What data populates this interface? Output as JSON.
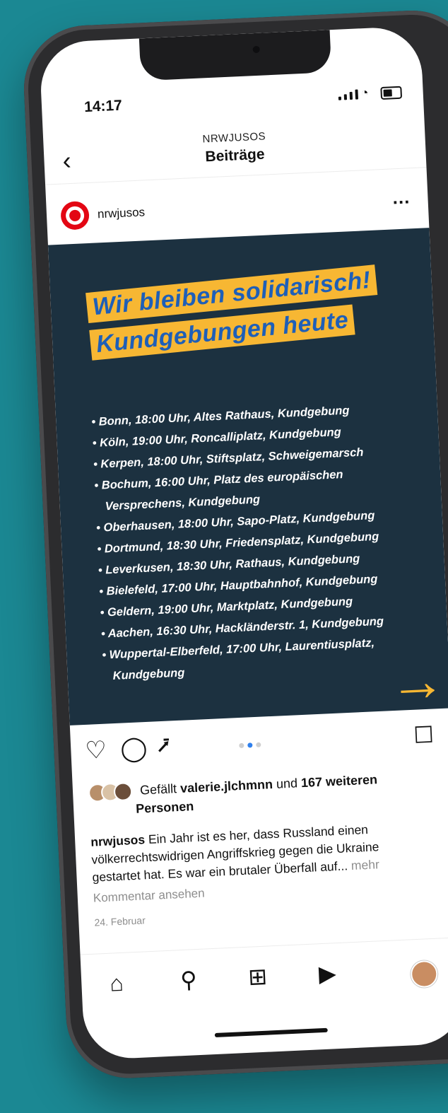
{
  "status": {
    "time": "14:17"
  },
  "header": {
    "account": "NRWJUSOS",
    "title": "Beiträge"
  },
  "post": {
    "username": "nrwjusos",
    "image": {
      "headline_line1": "Wir bleiben solidarisch!",
      "headline_line2": "Kundgebungen heute",
      "events": [
        "Bonn, 18:00 Uhr, Altes Rathaus, Kundgebung",
        "Köln, 19:00 Uhr, Roncalliplatz, Kundgebung",
        "Kerpen, 18:00 Uhr, Stiftsplatz, Schweigemarsch",
        "Bochum, 16:00 Uhr, Platz des europäischen Versprechens, Kundgebung",
        "Oberhausen, 18:00 Uhr, Sapo-Platz, Kundgebung",
        "Dortmund, 18:30 Uhr, Friedensplatz, Kundgebung",
        "Leverkusen, 18:30 Uhr, Rathaus, Kundgebung",
        "Bielefeld, 17:00 Uhr, Hauptbahnhof, Kundgebung",
        "Geldern, 19:00 Uhr, Marktplatz, Kundgebung",
        "Aachen, 16:30 Uhr, Hackländerstr. 1, Kundgebung",
        "Wuppertal-Elberfeld, 17:00 Uhr, Laurentiusplatz, Kundgebung"
      ]
    },
    "carousel": {
      "total": 3,
      "active": 2
    },
    "likes": {
      "prefix": "Gefällt",
      "user": "valerie.jlchmnn",
      "middle": "und",
      "count": "167 weiteren",
      "suffix": "Personen"
    },
    "caption": {
      "username": "nrwjusos",
      "text": "Ein Jahr ist es her, dass Russland einen völkerrechtswidrigen Angriffskrieg gegen die Ukraine gestartet hat. Es war ein brutaler Überfall auf...",
      "more": "mehr"
    },
    "comments_link": "Kommentar ansehen",
    "date": "24. Februar"
  },
  "colors": {
    "background": "#1b8893",
    "post_bg": "#1c3140",
    "highlight": "#f7b733",
    "headline_text": "#1e5fb8",
    "brand_red": "#e30613"
  },
  "icons": {
    "back": "chevron-left-icon",
    "more": "more-horizontal-icon",
    "like": "heart-icon",
    "comment": "comment-icon",
    "share": "send-icon",
    "save": "bookmark-icon",
    "tabs": [
      "home-icon",
      "search-icon",
      "add-post-icon",
      "reels-icon",
      "profile-avatar"
    ]
  }
}
